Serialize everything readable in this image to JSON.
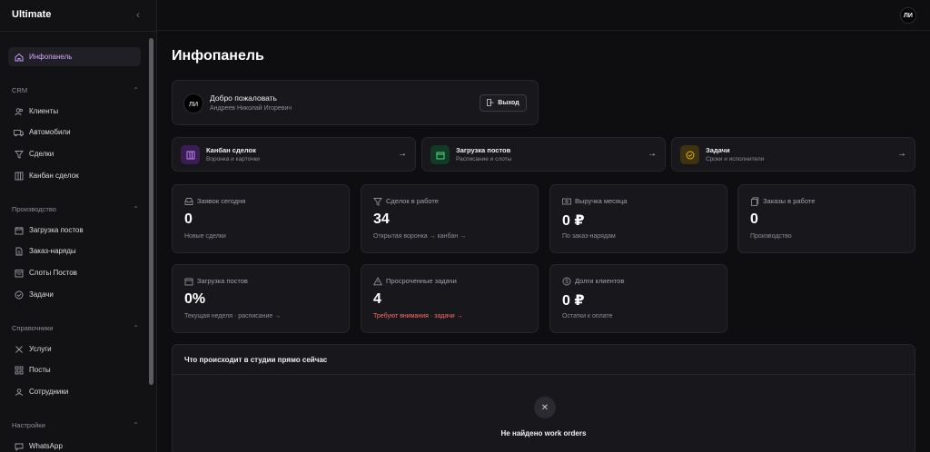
{
  "app": {
    "brand": "Ultimate",
    "user_initials": "ЛИ"
  },
  "sidebar": {
    "main": {
      "label": "Инфопанель",
      "icon": "home-icon"
    },
    "sections": [
      {
        "title": "CRM",
        "items": [
          {
            "label": "Клиенты",
            "icon": "users-icon"
          },
          {
            "label": "Автомобили",
            "icon": "car-icon"
          },
          {
            "label": "Сделки",
            "icon": "filter-icon"
          },
          {
            "label": "Канбан сделок",
            "icon": "kanban-icon"
          }
        ]
      },
      {
        "title": "Производство",
        "items": [
          {
            "label": "Загрузка постов",
            "icon": "calendar-icon"
          },
          {
            "label": "Заказ-наряды",
            "icon": "file-icon"
          },
          {
            "label": "Слоты Постов",
            "icon": "clock-icon"
          },
          {
            "label": "Задачи",
            "icon": "check-circle-icon"
          }
        ]
      },
      {
        "title": "Справочники",
        "items": [
          {
            "label": "Услуги",
            "icon": "wrench-icon"
          },
          {
            "label": "Посты",
            "icon": "grid-icon"
          },
          {
            "label": "Сотрудники",
            "icon": "team-icon"
          }
        ]
      },
      {
        "title": "Настройки",
        "items": [
          {
            "label": "WhatsApp",
            "icon": "chat-icon"
          }
        ]
      }
    ]
  },
  "main": {
    "title": "Инфопанель",
    "welcome": {
      "avatar": "ЛИ",
      "greeting": "Добро пожаловать",
      "name": "Андреев Николай Игоревич",
      "logout": "Выход"
    },
    "quick_links": [
      {
        "title": "Канбан сделок",
        "subtitle": "Воронка и карточки",
        "arrow": "→",
        "color": "#a855f7"
      },
      {
        "title": "Загрузка постов",
        "subtitle": "Расписание и слоты",
        "arrow": "→",
        "color": "#22c55e"
      },
      {
        "title": "Задачи",
        "subtitle": "Сроки и исполнители",
        "arrow": "→",
        "color": "#eab308"
      }
    ],
    "stats": [
      {
        "label": "Заявок сегодня",
        "value": "0",
        "sub": "Новые сделки",
        "icon": "inbox-icon"
      },
      {
        "label": "Сделок в работе",
        "value": "34",
        "sub": "Открытая воронка → канбан →",
        "icon": "filter-icon"
      },
      {
        "label": "Выручка месяца",
        "value": "0 ₽",
        "sub": "По заказ-нарядам",
        "icon": "money-icon"
      },
      {
        "label": "Заказы в работе",
        "value": "0",
        "sub": "Производство",
        "icon": "orders-icon"
      },
      {
        "label": "Загрузка постов",
        "value": "0%",
        "sub": "Текущая неделя · расписание →",
        "icon": "calendar-icon"
      },
      {
        "label": "Просроченные задачи",
        "value": "4",
        "sub": "Требуют внимания · задачи →",
        "icon": "warning-icon",
        "alert": true
      },
      {
        "label": "Долги клиентов",
        "value": "0 ₽",
        "sub": "Остатки к оплате",
        "icon": "dollar-icon"
      }
    ],
    "activity": {
      "title": "Что происходит в студии прямо сейчас",
      "empty": "Не найдено work orders"
    }
  },
  "colors": {
    "accent": "#c89bf5",
    "alert": "#ff6a6a",
    "background": "#0e0e11",
    "card": "#18181c"
  }
}
